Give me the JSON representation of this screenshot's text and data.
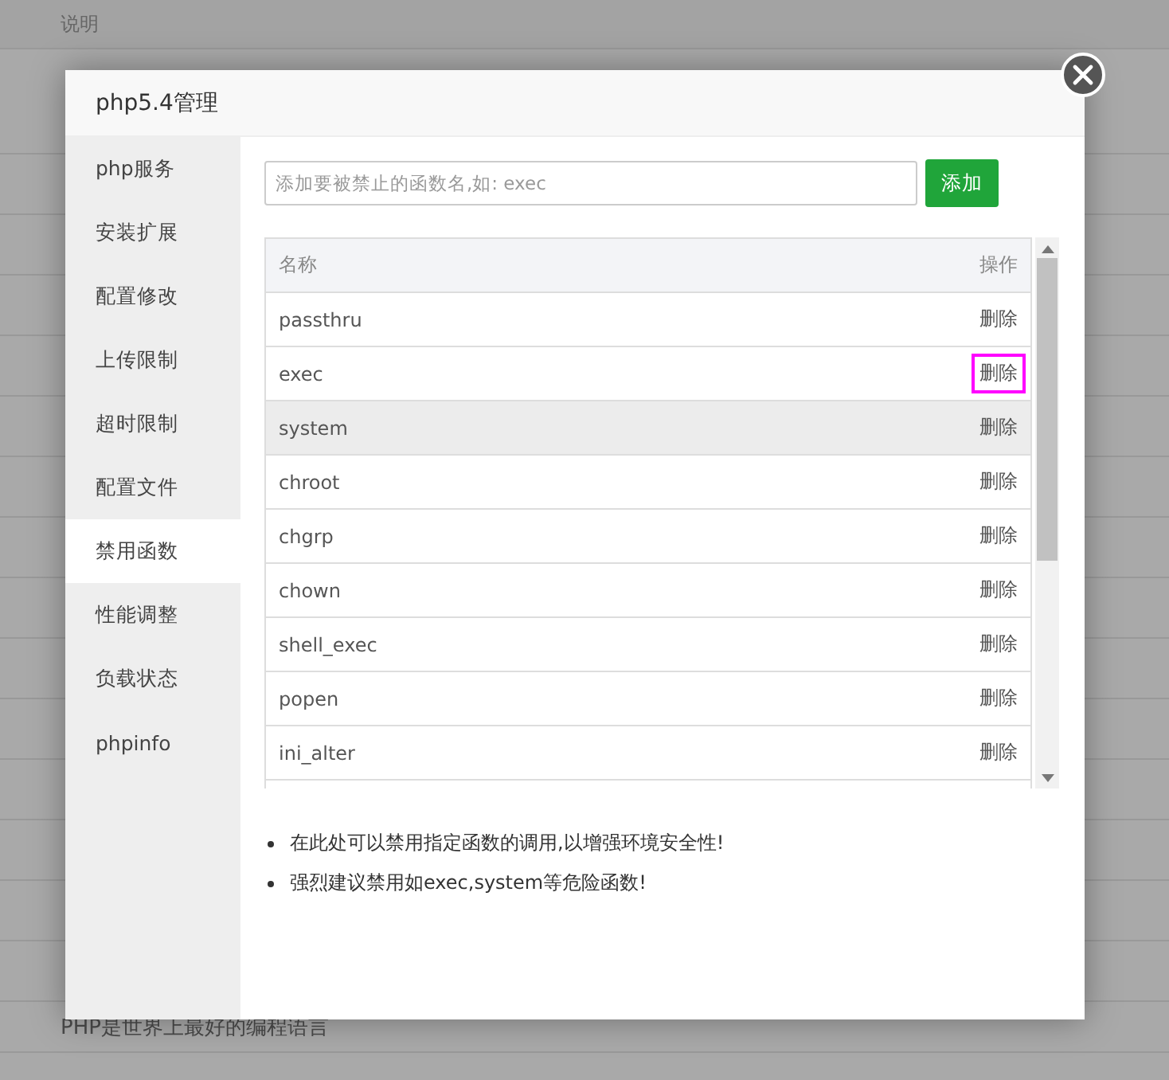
{
  "background_page": {
    "column_header": "说明",
    "rows": [
      "PHP是世界上最好的编程语言"
    ]
  },
  "dialog": {
    "title": "php5.4管理",
    "sidebar": {
      "items": [
        {
          "label": "php服务",
          "selected": false
        },
        {
          "label": "安装扩展",
          "selected": false
        },
        {
          "label": "配置修改",
          "selected": false
        },
        {
          "label": "上传限制",
          "selected": false
        },
        {
          "label": "超时限制",
          "selected": false
        },
        {
          "label": "配置文件",
          "selected": false
        },
        {
          "label": "禁用函数",
          "selected": true
        },
        {
          "label": "性能调整",
          "selected": false
        },
        {
          "label": "负载状态",
          "selected": false
        },
        {
          "label": "phpinfo",
          "selected": false
        }
      ]
    },
    "function_input": {
      "placeholder": "添加要被禁止的函数名,如: exec"
    },
    "add_button": "添加",
    "table": {
      "columns": [
        "名称",
        "操作"
      ],
      "rows": [
        {
          "name": "passthru",
          "action": "删除",
          "hovered": false,
          "highlighted": false
        },
        {
          "name": "exec",
          "action": "删除",
          "hovered": false,
          "highlighted": true
        },
        {
          "name": "system",
          "action": "删除",
          "hovered": true,
          "highlighted": false
        },
        {
          "name": "chroot",
          "action": "删除",
          "hovered": false,
          "highlighted": false
        },
        {
          "name": "chgrp",
          "action": "删除",
          "hovered": false,
          "highlighted": false
        },
        {
          "name": "chown",
          "action": "删除",
          "hovered": false,
          "highlighted": false
        },
        {
          "name": "shell_exec",
          "action": "删除",
          "hovered": false,
          "highlighted": false
        },
        {
          "name": "popen",
          "action": "删除",
          "hovered": false,
          "highlighted": false
        },
        {
          "name": "ini_alter",
          "action": "删除",
          "hovered": false,
          "highlighted": false
        }
      ]
    },
    "notes": [
      "在此处可以禁用指定函数的调用,以增强环境安全性!",
      "强烈建议禁用如exec,system等危险函数!"
    ]
  }
}
